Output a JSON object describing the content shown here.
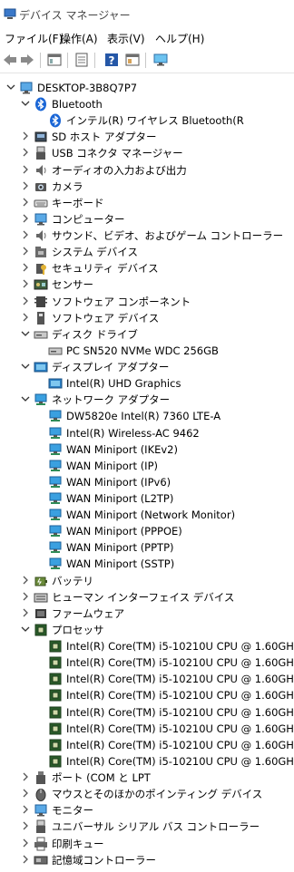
{
  "window": {
    "title": "デバイス マネージャー",
    "menus": [
      "ファイル(F)",
      "操作(A)",
      "表示(V)",
      "ヘルプ(H)"
    ]
  },
  "toolbar": {
    "buttons": [
      "back-icon",
      "forward-icon",
      "properties-panel-icon",
      "document-icon",
      "help-icon",
      "view-pane-icon",
      "monitor-scan-icon"
    ]
  },
  "tree": [
    {
      "label": "DESKTOP-3B8Q7P7",
      "level": 0,
      "expanded": true,
      "icon": "computer-root"
    },
    {
      "label": "Bluetooth",
      "level": 1,
      "expanded": true,
      "icon": "bluetooth"
    },
    {
      "label": "インテル(R) ワイヤレス Bluetooth(R",
      "level": 2,
      "icon": "bluetooth"
    },
    {
      "label": "SD ホスト アダプター",
      "level": 1,
      "expanded": false,
      "icon": "sd-host"
    },
    {
      "label": "USB コネクタ マネージャー",
      "level": 1,
      "expanded": false,
      "icon": "usb"
    },
    {
      "label": "オーディオの入力および出力",
      "level": 1,
      "expanded": false,
      "icon": "audio"
    },
    {
      "label": "カメラ",
      "level": 1,
      "expanded": false,
      "icon": "camera"
    },
    {
      "label": "キーボード",
      "level": 1,
      "expanded": false,
      "icon": "keyboard"
    },
    {
      "label": "コンピューター",
      "level": 1,
      "expanded": false,
      "icon": "monitor"
    },
    {
      "label": "サウンド、ビデオ、およびゲーム コントローラー",
      "level": 1,
      "expanded": false,
      "icon": "audio"
    },
    {
      "label": "システム デバイス",
      "level": 1,
      "expanded": false,
      "icon": "system-folder"
    },
    {
      "label": "セキュリティ デバイス",
      "level": 1,
      "expanded": false,
      "icon": "security-key"
    },
    {
      "label": "センサー",
      "level": 1,
      "expanded": false,
      "icon": "sensor"
    },
    {
      "label": "ソフトウェア コンポーネント",
      "level": 1,
      "expanded": false,
      "icon": "software-component"
    },
    {
      "label": "ソフトウェア デバイス",
      "level": 1,
      "expanded": false,
      "icon": "software-device"
    },
    {
      "label": "ディスク ドライブ",
      "level": 1,
      "expanded": true,
      "icon": "disk"
    },
    {
      "label": "PC SN520 NVMe WDC 256GB",
      "level": 2,
      "icon": "disk"
    },
    {
      "label": "ディスプレイ アダプター",
      "level": 1,
      "expanded": true,
      "icon": "display-adapter"
    },
    {
      "label": "Intel(R) UHD Graphics",
      "level": 2,
      "icon": "display-adapter"
    },
    {
      "label": "ネットワーク アダプター",
      "level": 1,
      "expanded": true,
      "icon": "network"
    },
    {
      "label": "DW5820e Intel(R) 7360 LTE-A",
      "level": 2,
      "icon": "network"
    },
    {
      "label": "Intel(R) Wireless-AC 9462",
      "level": 2,
      "icon": "network"
    },
    {
      "label": "WAN Miniport (IKEv2)",
      "level": 2,
      "icon": "network"
    },
    {
      "label": "WAN Miniport (IP)",
      "level": 2,
      "icon": "network"
    },
    {
      "label": "WAN Miniport (IPv6)",
      "level": 2,
      "icon": "network"
    },
    {
      "label": "WAN Miniport (L2TP)",
      "level": 2,
      "icon": "network"
    },
    {
      "label": "WAN Miniport (Network Monitor)",
      "level": 2,
      "icon": "network"
    },
    {
      "label": "WAN Miniport (PPPOE)",
      "level": 2,
      "icon": "network"
    },
    {
      "label": "WAN Miniport (PPTP)",
      "level": 2,
      "icon": "network"
    },
    {
      "label": "WAN Miniport (SSTP)",
      "level": 2,
      "icon": "network"
    },
    {
      "label": "バッテリ",
      "level": 1,
      "expanded": false,
      "icon": "battery"
    },
    {
      "label": "ヒューマン インターフェイス デバイス",
      "level": 1,
      "expanded": false,
      "icon": "hid"
    },
    {
      "label": "ファームウェア",
      "level": 1,
      "expanded": false,
      "icon": "firmware"
    },
    {
      "label": "プロセッサ",
      "level": 1,
      "expanded": true,
      "icon": "processor"
    },
    {
      "label": "Intel(R) Core(TM) i5-10210U CPU @ 1.60GH",
      "level": 2,
      "icon": "processor"
    },
    {
      "label": "Intel(R) Core(TM) i5-10210U CPU @ 1.60GH",
      "level": 2,
      "icon": "processor"
    },
    {
      "label": "Intel(R) Core(TM) i5-10210U CPU @ 1.60GH",
      "level": 2,
      "icon": "processor"
    },
    {
      "label": "Intel(R) Core(TM) i5-10210U CPU @ 1.60GH",
      "level": 2,
      "icon": "processor"
    },
    {
      "label": "Intel(R) Core(TM) i5-10210U CPU @ 1.60GH",
      "level": 2,
      "icon": "processor"
    },
    {
      "label": "Intel(R) Core(TM) i5-10210U CPU @ 1.60GH",
      "level": 2,
      "icon": "processor"
    },
    {
      "label": "Intel(R) Core(TM) i5-10210U CPU @ 1.60GH",
      "level": 2,
      "icon": "processor"
    },
    {
      "label": "Intel(R) Core(TM) i5-10210U CPU @ 1.60GH",
      "level": 2,
      "icon": "processor"
    },
    {
      "label": "ポート (COM と LPT",
      "level": 1,
      "expanded": false,
      "icon": "port"
    },
    {
      "label": "マウスとそのほかのポインティング デバイス",
      "level": 1,
      "expanded": false,
      "icon": "mouse"
    },
    {
      "label": "モニター",
      "level": 1,
      "expanded": false,
      "icon": "monitor"
    },
    {
      "label": "ユニバーサル シリアル バス コントローラー",
      "level": 1,
      "expanded": false,
      "icon": "usb"
    },
    {
      "label": "印刷キュー",
      "level": 1,
      "expanded": false,
      "icon": "printer"
    },
    {
      "label": "記憶域コントローラー",
      "level": 1,
      "expanded": false,
      "icon": "storage"
    }
  ]
}
